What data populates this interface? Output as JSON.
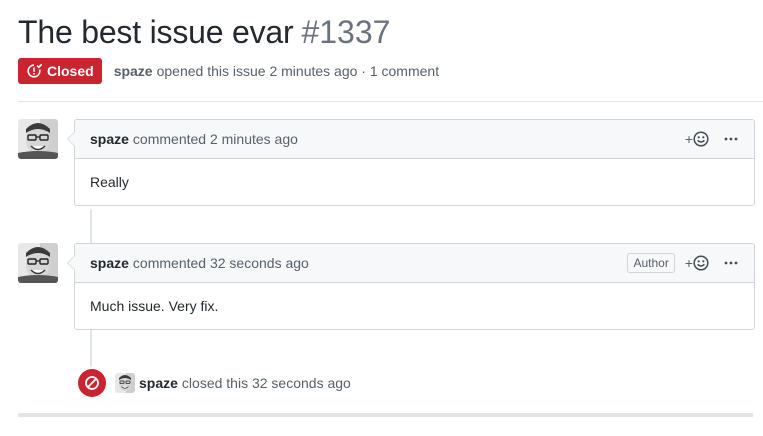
{
  "issue": {
    "title": "The best issue evar",
    "number": "#1337",
    "state_label": "Closed",
    "author": "spaze",
    "meta_text": "opened this issue 2 minutes ago · 1 comment"
  },
  "comments": [
    {
      "author": "spaze",
      "meta": "commented 2 minutes ago",
      "body": "Really",
      "author_label": ""
    },
    {
      "author": "spaze",
      "meta": "commented 32 seconds ago",
      "body": "Much issue. Very fix.",
      "author_label": "Author"
    }
  ],
  "reaction_button": "+",
  "close_event": {
    "author": "spaze",
    "text": "closed this 32 seconds ago"
  },
  "colors": {
    "closed_red": "#cb2431",
    "muted_text": "#586069",
    "border": "#d1d5da",
    "header_bg": "#f6f8fa"
  },
  "icons": [
    "issue-closed-icon",
    "smiley-icon",
    "kebab-horizontal-icon",
    "circle-slash-icon"
  ]
}
